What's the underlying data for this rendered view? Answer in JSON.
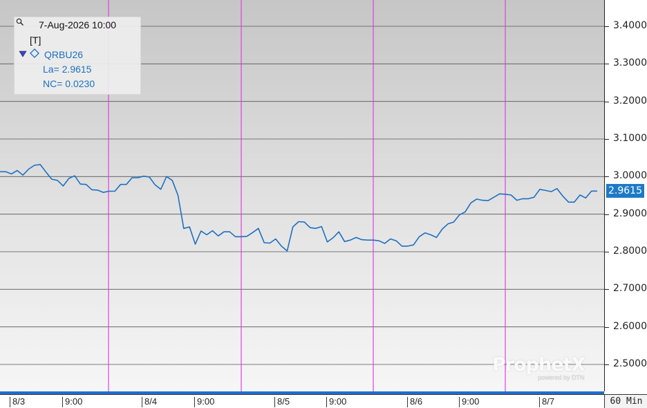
{
  "legend": {
    "timestamp": "7-Aug-2026 10:00",
    "tag": "[T]",
    "symbol": "QRBU26",
    "last": "La= 2.9615",
    "net_change": "NC= 0.0230"
  },
  "last_price_label": "2.9615",
  "interval": "60 Min",
  "watermark": "ProphetX",
  "watermark_sub": "powered by DTN",
  "colors": {
    "line": "#1d6fc0",
    "session_divider": "#e040e0",
    "last_price_bg": "#1d7ac7",
    "grid": "#555555"
  },
  "icons": {
    "magnifier": "magnifier-icon",
    "marker": "triangle-down-icon",
    "series": "diamond-icon"
  },
  "chart_data": {
    "type": "line",
    "series": [
      {
        "name": "QRBU26",
        "values": [
          3.013,
          3.013,
          3.007,
          3.016,
          3.004,
          3.02,
          3.03,
          3.032,
          3.012,
          2.993,
          2.99,
          2.975,
          2.995,
          3.002,
          2.98,
          2.979,
          2.965,
          2.964,
          2.958,
          2.961,
          2.961,
          2.979,
          2.979,
          2.997,
          2.997,
          3.001,
          2.999,
          2.978,
          2.966,
          3.0,
          2.99,
          2.95,
          2.862,
          2.866,
          2.82,
          2.855,
          2.845,
          2.856,
          2.842,
          2.853,
          2.853,
          2.84,
          2.84,
          2.841,
          2.851,
          2.862,
          2.824,
          2.823,
          2.834,
          2.815,
          2.802,
          2.866,
          2.88,
          2.879,
          2.864,
          2.862,
          2.867,
          2.826,
          2.837,
          2.853,
          2.827,
          2.831,
          2.838,
          2.832,
          2.831,
          2.831,
          2.829,
          2.822,
          2.834,
          2.829,
          2.815,
          2.815,
          2.818,
          2.84,
          2.85,
          2.845,
          2.838,
          2.86,
          2.874,
          2.879,
          2.898,
          2.906,
          2.93,
          2.94,
          2.937,
          2.936,
          2.945,
          2.954,
          2.953,
          2.951,
          2.937,
          2.941,
          2.941,
          2.945,
          2.966,
          2.963,
          2.96,
          2.968,
          2.948,
          2.932,
          2.932,
          2.951,
          2.943,
          2.9615,
          2.9615
        ]
      }
    ],
    "x_tick_labels": [
      "8/3",
      "9:00",
      "8/4",
      "9:00",
      "8/5",
      "9:00",
      "8/6",
      "9:00",
      "8/7"
    ],
    "y_tick_labels": [
      "2.5000",
      "2.6000",
      "2.7000",
      "2.8000",
      "2.9000",
      "3.0000",
      "3.1000",
      "3.2000",
      "3.3000",
      "3.4000"
    ],
    "ylim": [
      2.43,
      3.46
    ],
    "grid": true,
    "legend_position": "top-left"
  }
}
